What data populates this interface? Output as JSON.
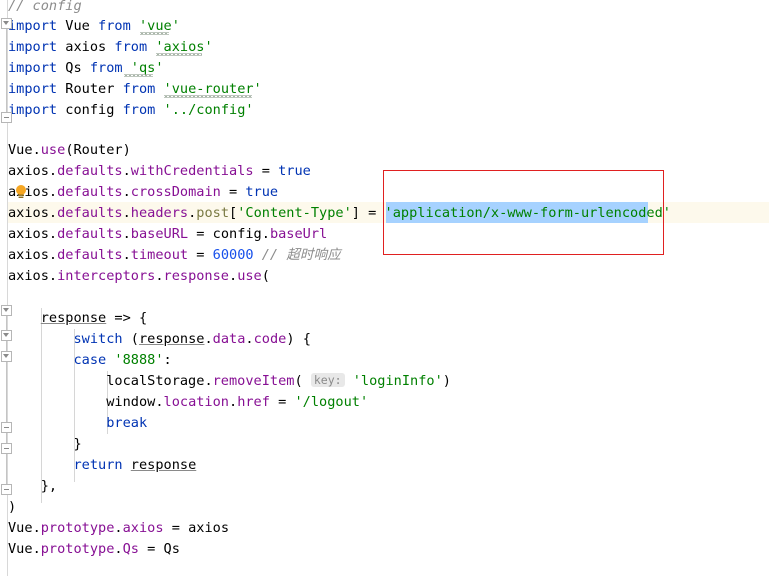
{
  "editor": {
    "language": "javascript",
    "theme": "IntelliJ Light",
    "colors": {
      "background": "#ffffff",
      "text": "#000000",
      "keyword": "#0033b3",
      "string": "#008000",
      "number": "#1750eb",
      "comment": "#8c8c8c",
      "property": "#871094",
      "selection": "#a6d2ff",
      "current_line": "#fdf9ec",
      "annotation_box": "#e02020",
      "gutter_border": "#d8d8d8",
      "hint_chip_bg": "#e8e8e8"
    }
  },
  "annotation": {
    "name": "red-highlight-rectangle",
    "target_text": "'application/x-www-form-urlencoded'",
    "color": "#e02020"
  },
  "selection": {
    "text": "application/x-www-form-urlencoded",
    "color": "#a6d2ff"
  },
  "intention_icon": {
    "name": "lightbulb-icon",
    "line": 8,
    "tooltip": "Show context actions"
  },
  "code": {
    "lines": [
      {
        "n": 1,
        "indent": 0,
        "text": "// config"
      },
      {
        "n": 2,
        "indent": 0,
        "text": "import Vue from 'vue'"
      },
      {
        "n": 3,
        "indent": 0,
        "text": "import axios from 'axios'"
      },
      {
        "n": 4,
        "indent": 0,
        "text": "import Qs from 'qs'"
      },
      {
        "n": 5,
        "indent": 0,
        "text": "import Router from 'vue-router'"
      },
      {
        "n": 6,
        "indent": 0,
        "text": "import config from '../config'"
      },
      {
        "n": 7,
        "indent": 0,
        "text": ""
      },
      {
        "n": 8,
        "indent": 0,
        "text": "Vue.use(Router)"
      },
      {
        "n": 9,
        "indent": 0,
        "text": "axios.defaults.withCredentials = true"
      },
      {
        "n": 10,
        "indent": 0,
        "text": "axios.defaults.crossDomain = true"
      },
      {
        "n": 11,
        "indent": 0,
        "text": "axios.defaults.headers.post['Content-Type'] = 'application/x-www-form-urlencoded'"
      },
      {
        "n": 12,
        "indent": 0,
        "text": "axios.defaults.baseURL = config.baseUrl"
      },
      {
        "n": 13,
        "indent": 0,
        "text": "axios.defaults.timeout = 60000 // 超时响应"
      },
      {
        "n": 14,
        "indent": 0,
        "text": "axios.interceptors.response.use("
      },
      {
        "n": 15,
        "indent": 0,
        "text": ""
      },
      {
        "n": 16,
        "indent": 1,
        "text": "response => {"
      },
      {
        "n": 17,
        "indent": 2,
        "text": "switch (response.data.code) {"
      },
      {
        "n": 18,
        "indent": 2,
        "text": "case '8888':"
      },
      {
        "n": 19,
        "indent": 3,
        "text": "localStorage.removeItem( key: 'loginInfo')"
      },
      {
        "n": 20,
        "indent": 3,
        "text": "window.location.href = '/logout'"
      },
      {
        "n": 21,
        "indent": 3,
        "text": "break"
      },
      {
        "n": 22,
        "indent": 2,
        "text": "}"
      },
      {
        "n": 23,
        "indent": 2,
        "text": "return response"
      },
      {
        "n": 24,
        "indent": 1,
        "text": "},"
      },
      {
        "n": 25,
        "indent": 0,
        "text": ")"
      },
      {
        "n": 26,
        "indent": 0,
        "text": "Vue.prototype.axios = axios"
      },
      {
        "n": 27,
        "indent": 0,
        "text": "Vue.prototype.Qs = Qs"
      }
    ],
    "tokens": {
      "comment_config": "// config",
      "kw_import": "import",
      "kw_from": "from",
      "kw_true": "true",
      "kw_switch": "switch",
      "kw_case": "case",
      "kw_break": "break",
      "kw_return": "return",
      "id_vue": "Vue",
      "id_axios": "axios",
      "id_qs": "Qs",
      "id_router": "Router",
      "id_config": "config",
      "id_response": "response",
      "id_localstorage": "localStorage",
      "id_window": "window",
      "str_vue": "'vue'",
      "str_axios": "'axios'",
      "str_qs": "'qs'",
      "str_vue_router": "'vue-router'",
      "str_config_path": "'../config'",
      "str_content_type": "'Content-Type'",
      "str_urlencoded": "'application/x-www-form-urlencoded'",
      "str_8888": "'8888'",
      "str_login_info": "'loginInfo'",
      "str_logout": "'/logout'",
      "num_timeout": "60000",
      "comment_timeout": "// 超时响应",
      "prop_defaults": "defaults",
      "prop_with_credentials": "withCredentials",
      "prop_cross_domain": "crossDomain",
      "prop_headers": "headers",
      "prop_post": "post",
      "prop_base_url_field": "baseURL",
      "prop_base_url_value": "baseUrl",
      "prop_timeout": "timeout",
      "prop_interceptors": "interceptors",
      "prop_response": "response",
      "prop_use": "use",
      "prop_data": "data",
      "prop_code": "code",
      "prop_remove_item": "removeItem",
      "prop_location": "location",
      "prop_href": "href",
      "prop_prototype": "prototype",
      "hint_key": "key:"
    }
  }
}
